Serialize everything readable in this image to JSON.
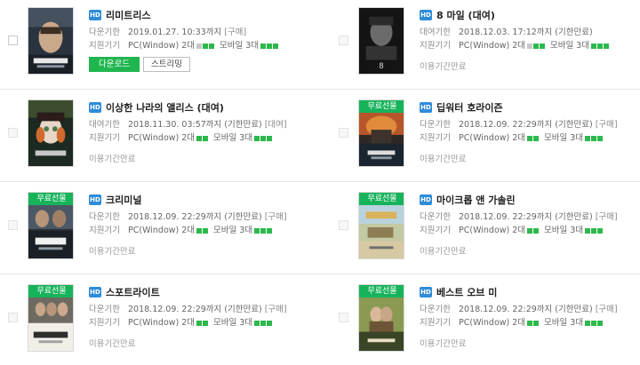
{
  "labels": {
    "hd": "HD",
    "free_gift": "무료선물",
    "download_limit": "다운기한",
    "rental_limit": "대여기한",
    "devices": "지원기기",
    "pc": "PC(Window) 2대",
    "mobile": "모바일 3대",
    "expired": "이용기간만료",
    "download_button": "다운로드",
    "streaming_button": "스트리밍"
  },
  "colors": {
    "green": "#2cb84b",
    "hd_blue": "#2f8cd9",
    "gray": "#c8c8c8"
  },
  "items": [
    {
      "title": "리미트리스",
      "limit_label": "다운기한",
      "date": "2019.01.27. 10:33까지",
      "tag": "[구매]",
      "pc_dots": [
        0,
        1,
        1
      ],
      "mobile_dots": [
        1,
        1,
        1
      ],
      "free": false,
      "has_buttons": true,
      "expired": false,
      "poster_icon": "limitless-poster"
    },
    {
      "title": "8 마일 (대여)",
      "limit_label": "대여기한",
      "date": "2018.12.03. 17:12까지 (기한만료)",
      "tag": "",
      "pc_dots": [
        0,
        1,
        1
      ],
      "mobile_dots": [
        1,
        1,
        1
      ],
      "free": false,
      "has_buttons": false,
      "expired": true,
      "poster_icon": "8mile-poster"
    },
    {
      "title": "이상한 나라의 앨리스 (대여)",
      "limit_label": "대여기한",
      "date": "2018.11.30. 03:57까지 (기한만료)",
      "tag": "[대여]",
      "pc_dots": [
        1,
        1
      ],
      "mobile_dots": [
        1,
        1,
        1
      ],
      "free": false,
      "has_buttons": false,
      "expired": true,
      "poster_icon": "alice-poster"
    },
    {
      "title": "딥워터 호라이즌",
      "limit_label": "다운기한",
      "date": "2018.12.09. 22:29까지 (기한만료)",
      "tag": "[구매]",
      "pc_dots": [
        1,
        1
      ],
      "mobile_dots": [
        1,
        1,
        1
      ],
      "free": true,
      "has_buttons": false,
      "expired": true,
      "poster_icon": "deepwater-poster"
    },
    {
      "title": "크리미널",
      "limit_label": "다운기한",
      "date": "2018.12.09. 22:29까지 (기한만료)",
      "tag": "[구매]",
      "pc_dots": [
        1,
        1
      ],
      "mobile_dots": [
        1,
        1,
        1
      ],
      "free": true,
      "has_buttons": false,
      "expired": true,
      "poster_icon": "criminal-poster"
    },
    {
      "title": "마이크롭 앤 가솔린",
      "limit_label": "다운기한",
      "date": "2018.12.09. 22:29까지 (기한만료)",
      "tag": "[구매]",
      "pc_dots": [
        1,
        1
      ],
      "mobile_dots": [
        1,
        1,
        1
      ],
      "free": true,
      "has_buttons": false,
      "expired": true,
      "poster_icon": "microbe-gasoline-poster"
    },
    {
      "title": "스포트라이트",
      "limit_label": "다운기한",
      "date": "2018.12.09. 22:29까지 (기한만료)",
      "tag": "[구매]",
      "pc_dots": [
        1,
        1
      ],
      "mobile_dots": [
        1,
        1,
        1
      ],
      "free": true,
      "has_buttons": false,
      "expired": true,
      "poster_icon": "spotlight-poster"
    },
    {
      "title": "베스트 오브 미",
      "limit_label": "다운기한",
      "date": "2018.12.09. 22:29까지 (기한만료)",
      "tag": "[구매]",
      "pc_dots": [
        1,
        1
      ],
      "mobile_dots": [
        1,
        1,
        1
      ],
      "free": true,
      "has_buttons": false,
      "expired": true,
      "poster_icon": "best-of-me-poster"
    }
  ]
}
